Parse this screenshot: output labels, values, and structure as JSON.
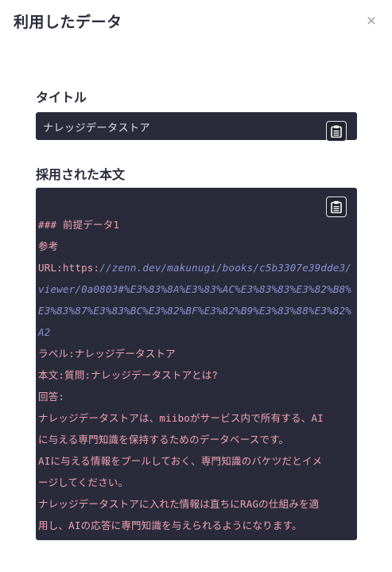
{
  "modal": {
    "title": "利用したデータ",
    "close_label": "×"
  },
  "title_section": {
    "label": "タイトル",
    "value": "ナレッジデータストア"
  },
  "content_section": {
    "label": "採用された本文",
    "lines": {
      "heading": "### 前提データ1",
      "sankou": "参考",
      "url_prefix": "URL:https:",
      "url_rest": "//zenn.dev/makunugi/books/c5b3307e39dde3/viewer/0a0803#%E3%83%8A%E3%83%AC%E3%83%83%E3%82%B8%E3%83%87%E3%83%BC%E3%82%BF%E3%82%B9%E3%83%88%E3%82%A2",
      "label_line": "ラベル:ナレッジデータストア",
      "body_line": "本文:質問:ナレッジデータストアとは?",
      "answer_label": "回答:",
      "p1a": "ナレッジデータストアは、miiboがサービス内で所有する、AI",
      "p1b": "に与える専門知識を保持するためのデータベースです。",
      "p2a": "AIに与える情報をプールしておく、専門知識のバケツだとイメ",
      "p2b": "ージしてください。",
      "p3a": "ナレッジデータストアに入れた情報は直ちにRAGの仕組みを適",
      "p3b": "用し、AIの応答に専門知識を与えられるようになります。"
    }
  },
  "icons": {
    "copy": "clipboard-icon",
    "close": "close-icon"
  },
  "colors": {
    "panel_bg": "#2a2b3a",
    "text_pink": "#f0a3b4",
    "url_italic": "#8a93d6"
  }
}
